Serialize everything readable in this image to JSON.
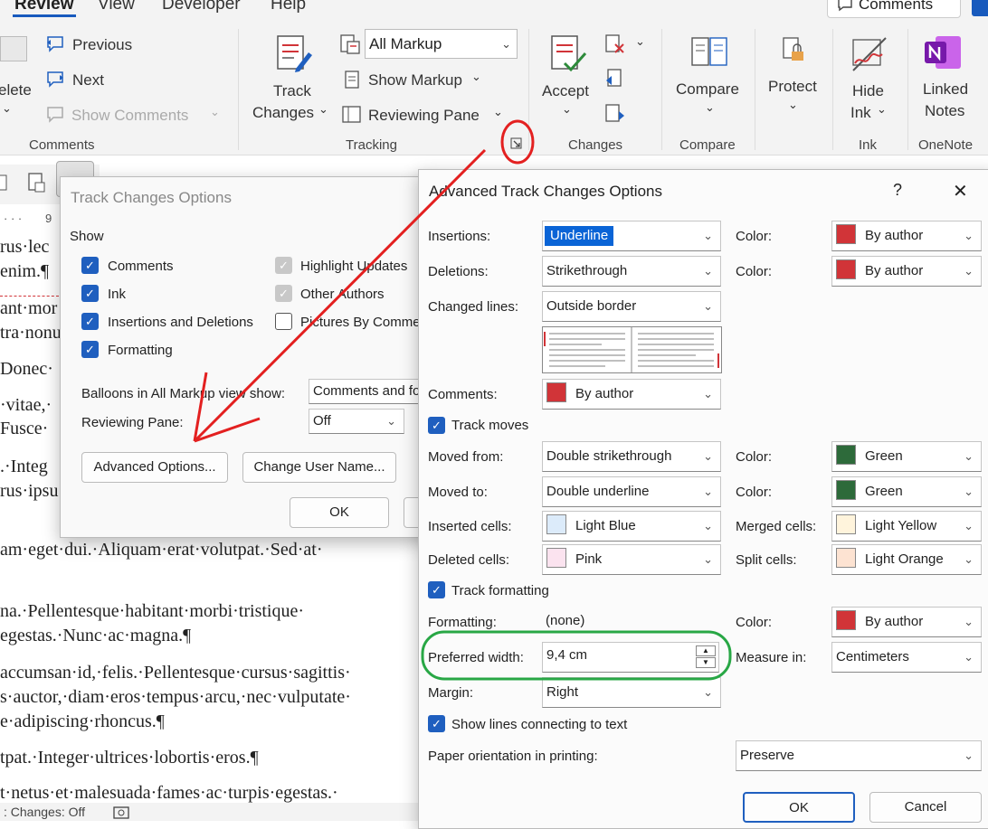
{
  "tabs": {
    "review": "Review",
    "view": "View",
    "developer": "Developer",
    "help": "Help",
    "comments_button": "Comments"
  },
  "ribbon": {
    "delete": "elete",
    "previous": "Previous",
    "next": "Next",
    "show_comments": "Show Comments",
    "group_comments": "Comments",
    "track_changes_1": "Track",
    "track_changes_2": "Changes",
    "markup_select": "All Markup",
    "show_markup": "Show Markup",
    "reviewing_pane": "Reviewing Pane",
    "group_tracking": "Tracking",
    "accept": "Accept",
    "group_changes": "Changes",
    "compare": "Compare",
    "group_compare": "Compare",
    "protect": "Protect",
    "hide_ink_1": "Hide",
    "hide_ink_2": "Ink",
    "group_ink": "Ink",
    "linked_notes_1": "Linked",
    "linked_notes_2": "Notes",
    "group_onenote": "OneNote",
    "ruler_mark": "9"
  },
  "document": {
    "lines": [
      "rus·lec",
      "enim.¶",
      "ant·mor",
      "tra·nonu",
      "Donec·",
      "·vitae,·",
      "Fusce·",
      ".·Integ",
      "rus·ipsu",
      "am·eget·dui.·Aliquam·erat·volutpat.·Sed·at·",
      "na.·Pellentesque·habitant·morbi·tristique·",
      "egestas.·Nunc·ac·magna.¶",
      "accumsan·id,·felis.·Pellentesque·cursus·sagittis·",
      "s·auctor,·diam·eros·tempus·arcu,·nec·vulputate·",
      "e·adipiscing·rhoncus.¶",
      "tpat.·Integer·ultrices·lobortis·eros.¶",
      "t·netus·et·malesuada·fames·ac·turpis·egestas.·"
    ],
    "status": ": Changes: Off"
  },
  "track_dialog": {
    "title": "Track Changes Options",
    "show_label": "Show",
    "comments": "Comments",
    "ink": "Ink",
    "insertions_deletions": "Insertions and Deletions",
    "formatting": "Formatting",
    "highlight_updates": "Highlight Updates",
    "other_authors": "Other Authors",
    "pictures_by_comments": "Pictures By Comme",
    "balloons_label": "Balloons in All Markup view show:",
    "balloons_value": "Comments and fo",
    "reviewing_pane_label": "Reviewing Pane:",
    "reviewing_pane_value": "Off",
    "advanced_options": "Advanced Options...",
    "change_user_name": "Change User Name...",
    "ok": "OK"
  },
  "advanced_dialog": {
    "title": "Advanced Track Changes Options",
    "help": "?",
    "close": "✕",
    "insertions_label": "Insertions:",
    "insertions_value": "Underline",
    "deletions_label": "Deletions:",
    "deletions_value": "Strikethrough",
    "changed_lines_label": "Changed lines:",
    "changed_lines_value": "Outside border",
    "comments_label": "Comments:",
    "comments_value": "By author",
    "color_label": "Color:",
    "insertions_color": "By author",
    "deletions_color": "By author",
    "track_moves": "Track moves",
    "moved_from_label": "Moved from:",
    "moved_from_value": "Double strikethrough",
    "moved_from_color": "Green",
    "moved_to_label": "Moved to:",
    "moved_to_value": "Double underline",
    "moved_to_color": "Green",
    "inserted_cells_label": "Inserted cells:",
    "inserted_cells_value": "Light Blue",
    "merged_cells_label": "Merged cells:",
    "merged_cells_value": "Light Yellow",
    "deleted_cells_label": "Deleted cells:",
    "deleted_cells_value": "Pink",
    "split_cells_label": "Split cells:",
    "split_cells_value": "Light Orange",
    "track_formatting": "Track formatting",
    "formatting_label": "Formatting:",
    "formatting_value": "(none)",
    "formatting_color": "By author",
    "preferred_width_label": "Preferred width:",
    "preferred_width_value": "9,4 cm",
    "measure_in_label": "Measure in:",
    "measure_in_value": "Centimeters",
    "margin_label": "Margin:",
    "margin_value": "Right",
    "show_lines": "Show lines connecting to text",
    "paper_orientation_label": "Paper orientation in printing:",
    "paper_orientation_value": "Preserve",
    "ok": "OK",
    "cancel": "Cancel"
  },
  "colors": {
    "by_author": "#d13438",
    "green": "#2d6a3a",
    "light_blue": "#dcebfa",
    "light_yellow": "#fff4dc",
    "pink": "#fbe3ef",
    "light_orange": "#fde3d2",
    "annotation_red": "#e32020",
    "annotation_green": "#28a745",
    "accent": "#185abd"
  }
}
